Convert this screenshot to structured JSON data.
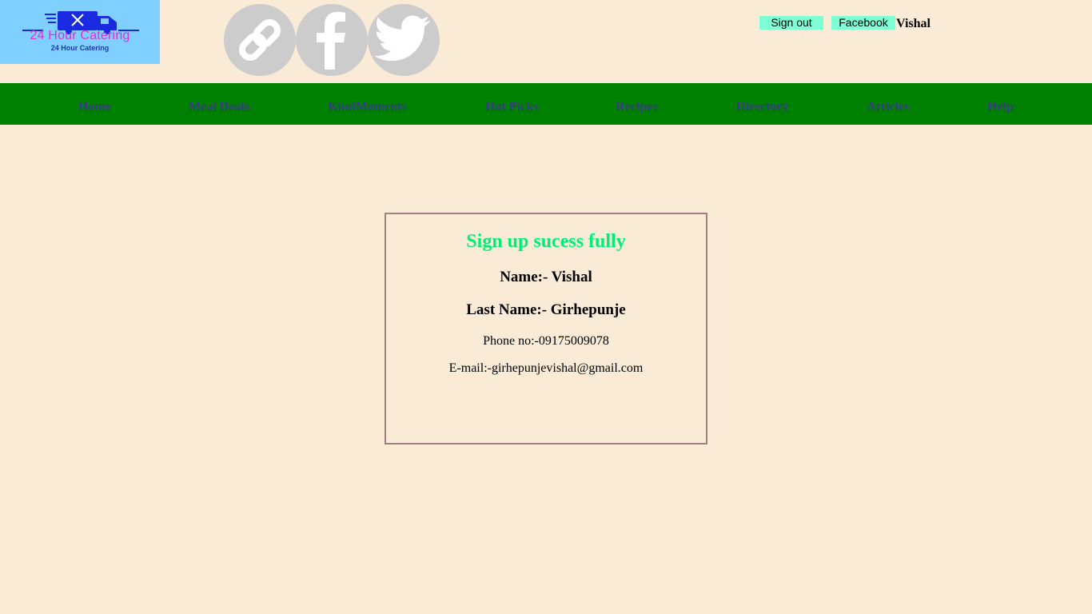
{
  "logo": {
    "title": "24 Hour Catering",
    "subtitle": "24 Hour Catering"
  },
  "social": [
    {
      "icon": "link-icon"
    },
    {
      "icon": "facebook-icon"
    },
    {
      "icon": "twitter-icon"
    }
  ],
  "header": {
    "signout_label": "Sign out",
    "facebook_label": "Facebook",
    "user_name": "Vishal"
  },
  "nav": {
    "items": [
      {
        "label": "Home"
      },
      {
        "label": "Meal Deals"
      },
      {
        "label": "KindMoments"
      },
      {
        "label": "Hot Picks"
      },
      {
        "label": "Recipes"
      },
      {
        "label": "Directory"
      },
      {
        "label": "Articles"
      },
      {
        "label": "Help"
      }
    ]
  },
  "card": {
    "heading": "Sign up sucess fully",
    "name": "Name:- Vishal",
    "last_name": "Last Name:- Girhepunje",
    "phone": "Phone no:-09175009078",
    "email": "E-mail:-girhepunjevishal@gmail.com"
  },
  "colors": {
    "background": "#faebd7",
    "nav_bar": "#008000",
    "nav_link": "#3a3a8c",
    "button": "#7fffd4",
    "heading": "#00ee76",
    "logo_bg": "#80d0ff"
  }
}
